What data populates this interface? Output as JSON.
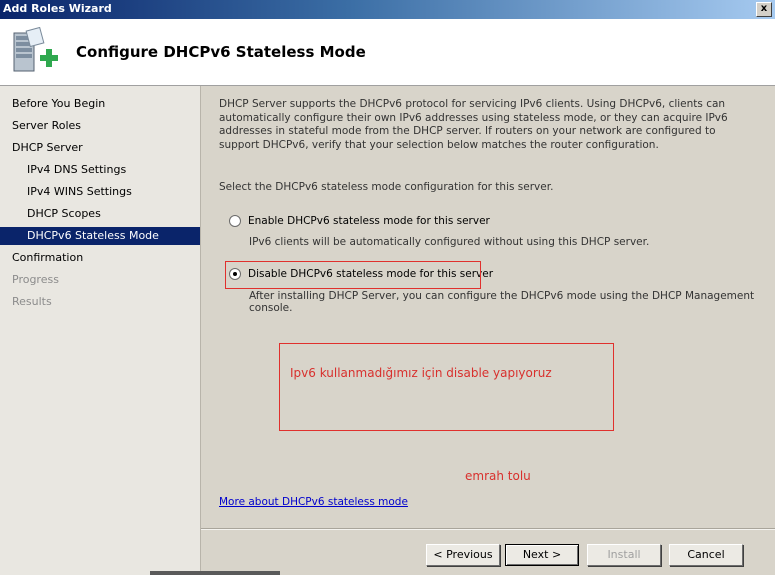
{
  "window": {
    "title": "Add Roles Wizard",
    "close_label": "x"
  },
  "header": {
    "heading": "Configure DHCPv6 Stateless Mode",
    "icon": "server-add-icon"
  },
  "sidebar": {
    "items": [
      {
        "label": "Before You Begin",
        "state": "normal",
        "level": 0
      },
      {
        "label": "Server Roles",
        "state": "normal",
        "level": 0
      },
      {
        "label": "DHCP Server",
        "state": "normal",
        "level": 0
      },
      {
        "label": "IPv4 DNS Settings",
        "state": "normal",
        "level": 1
      },
      {
        "label": "IPv4 WINS Settings",
        "state": "normal",
        "level": 1
      },
      {
        "label": "DHCP Scopes",
        "state": "normal",
        "level": 1
      },
      {
        "label": "DHCPv6 Stateless Mode",
        "state": "selected",
        "level": 1
      },
      {
        "label": "Confirmation",
        "state": "normal",
        "level": 0
      },
      {
        "label": "Progress",
        "state": "disabled",
        "level": 0
      },
      {
        "label": "Results",
        "state": "disabled",
        "level": 0
      }
    ]
  },
  "main": {
    "intro": "DHCP Server supports the DHCPv6 protocol for servicing IPv6 clients. Using DHCPv6, clients can automatically configure their own IPv6 addresses using stateless mode, or they can acquire IPv6 addresses in stateful mode from the DHCP server. If routers on your network are configured to support DHCPv6, verify that your selection below matches the router configuration.",
    "prompt": "Select the DHCPv6 stateless mode configuration for this server.",
    "options": [
      {
        "label": "Enable DHCPv6 stateless mode for this server",
        "desc": "IPv6 clients will be automatically configured without using this DHCP server.",
        "checked": false
      },
      {
        "label": "Disable DHCPv6 stateless mode for this server",
        "desc": "After installing DHCP Server, you can configure the DHCPv6 mode using the DHCP Management console.",
        "checked": true
      }
    ],
    "annotation": "Ipv6 kullanmadığımız için disable yapıyoruz",
    "signature": "emrah tolu",
    "more_link": "More about DHCPv6 stateless mode"
  },
  "buttons": {
    "previous": "< Previous",
    "next": "Next >",
    "install": "Install",
    "cancel": "Cancel"
  },
  "colors": {
    "selected_nav": "#0a246a",
    "annotation": "#e0302d",
    "link": "#0000cc"
  }
}
